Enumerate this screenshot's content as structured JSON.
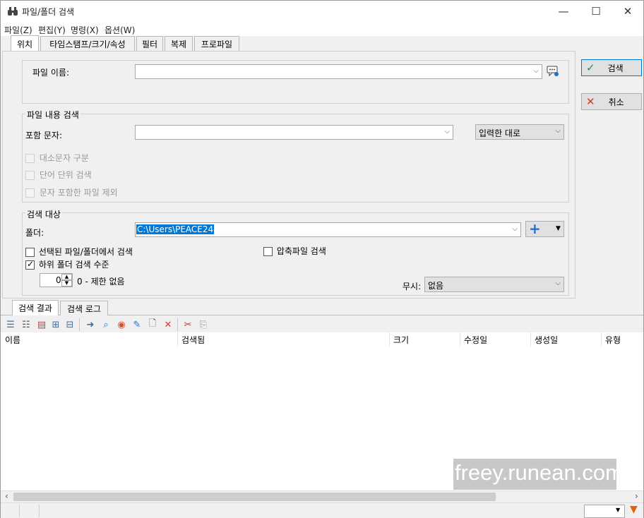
{
  "window": {
    "title": "파일/폴더 검색",
    "minimize": "—",
    "maximize": "☐",
    "close": "✕"
  },
  "menu": {
    "items": [
      "파일(Z)",
      "편집(Y)",
      "명령(X)",
      "옵션(W)"
    ]
  },
  "tabs": {
    "items": [
      "위치",
      "타임스탬프/크기/속성",
      "필터",
      "복제",
      "프로파일"
    ]
  },
  "location": {
    "file_name_label": "파일 이름:",
    "file_name_value": ""
  },
  "content_search": {
    "group_title": "파일 내용 검색",
    "contains_label": "포함 문자:",
    "contains_value": "",
    "mode_value": "입력한 대로",
    "options": [
      "대소문자 구분",
      "단어 단위 검색",
      "문자 포함한 파일 제외"
    ]
  },
  "search_target": {
    "group_title": "검색 대상",
    "folder_label": "폴더:",
    "folder_value": "C:\\Users\\PEACE24",
    "search_selected_label": "선택된 파일/폴더에서 검색",
    "search_selected_checked": false,
    "archive_label": "압축파일 검색",
    "archive_checked": false,
    "subfolder_label": "하위 폴더 검색 수준",
    "subfolder_checked": true,
    "level_value": "0",
    "level_note": "0 - 제한 없음",
    "ignore_label": "무시:",
    "ignore_value": "없음"
  },
  "actions": {
    "search_label": "검색",
    "cancel_label": "취소"
  },
  "bottom_tabs": {
    "items": [
      "검색 결과",
      "검색 로그"
    ]
  },
  "results": {
    "columns": [
      "이름",
      "검색됨",
      "크기",
      "수정일",
      "생성일",
      "유형"
    ],
    "rows": []
  },
  "watermark": "freey.runean.com",
  "colors": {
    "accent_check": "#2e8b3a",
    "cancel_x": "#d23b2b",
    "selection": "#0078d7",
    "plus": "#1e6fd0"
  }
}
